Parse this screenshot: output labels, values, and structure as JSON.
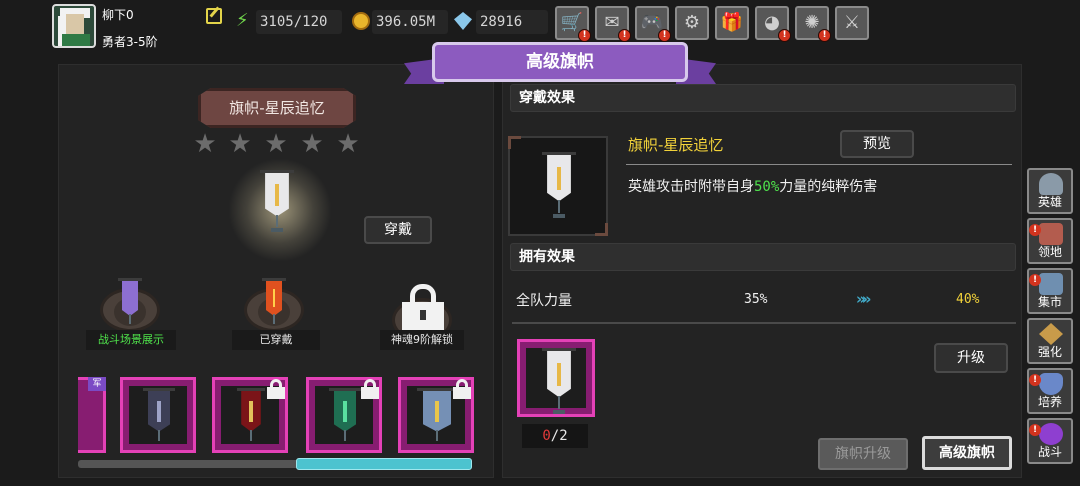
{
  "player": {
    "name": "柳下0",
    "rank": "勇者3-5阶"
  },
  "resources": {
    "energy": "3105/120",
    "gold": "396.05M",
    "gems": "28916"
  },
  "top_buttons": [
    {
      "name": "shop",
      "icon": "shopping-cart-icon",
      "badge": "!"
    },
    {
      "name": "mail",
      "icon": "mail-icon",
      "badge": "!"
    },
    {
      "name": "gamepad",
      "icon": "gamepad-icon",
      "badge": "!"
    },
    {
      "name": "settings",
      "icon": "gear-icon",
      "badge": ""
    },
    {
      "name": "gift",
      "icon": "gift-icon",
      "badge": ""
    },
    {
      "name": "wheel",
      "icon": "lucky-wheel-icon",
      "badge": "!"
    },
    {
      "name": "fireworks",
      "icon": "fireworks-icon",
      "badge": "!"
    },
    {
      "name": "battle",
      "icon": "crossed-swords-icon",
      "badge": ""
    }
  ],
  "title": "高级旗帜",
  "left": {
    "banner_name": "旗帜-星辰追忆",
    "stars": [
      "★",
      "★",
      "★",
      "★",
      "★"
    ],
    "equip_label": "穿戴",
    "pedestals": [
      {
        "label": "战斗场景展示",
        "color": "#4fe24b"
      },
      {
        "label": "已穿戴",
        "color": "#ffffff"
      },
      {
        "label": "神魂9阶解锁",
        "color": "#ffffff"
      }
    ],
    "partial_tag": "军"
  },
  "right": {
    "wear_header": "穿戴效果",
    "effect_name": "旗帜-星辰追忆",
    "preview_label": "预览",
    "effect_desc_prefix": "英雄攻击时附带自身",
    "effect_desc_value": "50%",
    "effect_desc_suffix": "力量的纯粹伤害",
    "own_header": "拥有效果",
    "stat": {
      "name": "全队力量",
      "current": "35%",
      "arrow": "»»",
      "next": "40%"
    },
    "material": {
      "have": "0",
      "need": "/2"
    },
    "upgrade_label": "升级",
    "tab_banner_upgrade": "旗帜升级",
    "tab_advanced_banner": "高级旗帜"
  },
  "side_nav": [
    {
      "label": "英雄",
      "icon": "hero-helmet-icon",
      "color": "#8a9aa8",
      "badge": ""
    },
    {
      "label": "领地",
      "icon": "castle-icon",
      "color": "#b35c4e",
      "badge": "!"
    },
    {
      "label": "集市",
      "icon": "market-icon",
      "color": "#6f8fb0",
      "badge": "!"
    },
    {
      "label": "强化",
      "icon": "enhance-crystal-icon",
      "color": "#c89b4a",
      "badge": ""
    },
    {
      "label": "培养",
      "icon": "cultivate-cup-icon",
      "color": "#6a88c9",
      "badge": "!"
    },
    {
      "label": "战斗",
      "icon": "battle-portal-icon",
      "color": "#8e3fd0",
      "badge": "!"
    }
  ]
}
